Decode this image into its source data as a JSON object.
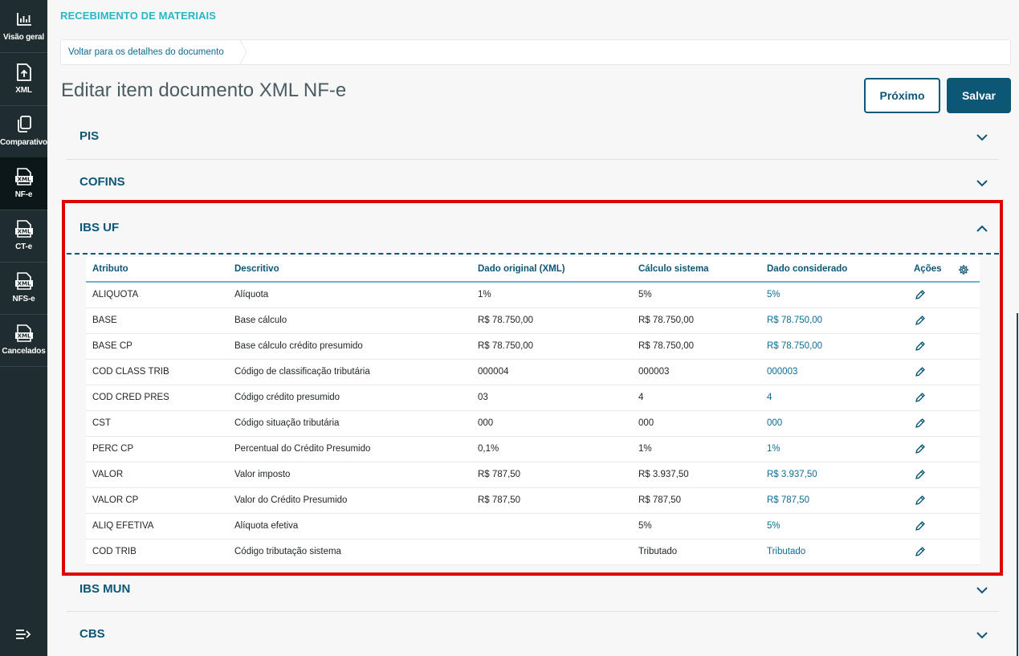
{
  "sidebar": {
    "items": [
      {
        "label": "Visão geral",
        "icon": "bar-chart-icon"
      },
      {
        "label": "XML",
        "icon": "file-upload-icon"
      },
      {
        "label": "Comparativo",
        "icon": "copy-icon"
      },
      {
        "label": "NF-e",
        "icon": "xml-file-icon"
      },
      {
        "label": "CT-e",
        "icon": "xml-file-icon"
      },
      {
        "label": "NFS-e",
        "icon": "xml-file-icon"
      },
      {
        "label": "Cancelados",
        "icon": "xml-file-icon"
      }
    ],
    "active": "NF-e",
    "collapse_icon": "collapse-menu-icon"
  },
  "module_title": "RECEBIMENTO DE MATERIAIS",
  "breadcrumb": {
    "link": "Voltar para os detalhes do documento"
  },
  "page_title": "Editar item documento XML NF-e",
  "buttons": {
    "next": "Próximo",
    "save": "Salvar"
  },
  "sections": {
    "pis": "PIS",
    "cofins": "COFINS",
    "ibs_uf": "IBS UF",
    "ibs_mun": "IBS MUN",
    "cbs": "CBS"
  },
  "table": {
    "headers": {
      "atributo": "Atributo",
      "descritivo": "Descritivo",
      "original": "Dado original (XML)",
      "calculo": "Cálculo sistema",
      "considerado": "Dado considerado",
      "acoes": "Ações"
    },
    "rows": [
      {
        "atributo": "ALIQUOTA",
        "descritivo": "Alíquota",
        "original": "1%",
        "calculo": "5%",
        "considerado": "5%"
      },
      {
        "atributo": "BASE",
        "descritivo": "Base cálculo",
        "original": "R$ 78.750,00",
        "calculo": "R$ 78.750,00",
        "considerado": "R$ 78.750,00"
      },
      {
        "atributo": "BASE CP",
        "descritivo": "Base cálculo crédito presumido",
        "original": "R$ 78.750,00",
        "calculo": "R$ 78.750,00",
        "considerado": "R$ 78.750,00"
      },
      {
        "atributo": "COD CLASS TRIB",
        "descritivo": "Código de classificação tributária",
        "original": "000004",
        "calculo": "000003",
        "considerado": "000003"
      },
      {
        "atributo": "COD CRED PRES",
        "descritivo": "Código crédito presumido",
        "original": "03",
        "calculo": "4",
        "considerado": "4"
      },
      {
        "atributo": "CST",
        "descritivo": "Código situação tributária",
        "original": "000",
        "calculo": "000",
        "considerado": "000"
      },
      {
        "atributo": "PERC CP",
        "descritivo": "Percentual do Crédito Presumido",
        "original": "0,1%",
        "calculo": "1%",
        "considerado": "1%"
      },
      {
        "atributo": "VALOR",
        "descritivo": "Valor imposto",
        "original": "R$ 787,50",
        "calculo": "R$ 3.937,50",
        "considerado": "R$ 3.937,50"
      },
      {
        "atributo": "VALOR CP",
        "descritivo": "Valor do Crédito Presumido",
        "original": "R$ 787,50",
        "calculo": "R$ 787,50",
        "considerado": "R$ 787,50"
      },
      {
        "atributo": "ALIQ EFETIVA",
        "descritivo": "Alíquota efetiva",
        "original": "",
        "calculo": "5%",
        "considerado": "5%"
      },
      {
        "atributo": "COD TRIB",
        "descritivo": "Código tributação sistema",
        "original": "",
        "calculo": "Tributado",
        "considerado": "Tributado"
      }
    ]
  },
  "colors": {
    "sidebar_bg": "#1f2d31",
    "primary": "#0c5676",
    "module_title": "#29b6c5",
    "highlight": "#e10000"
  }
}
